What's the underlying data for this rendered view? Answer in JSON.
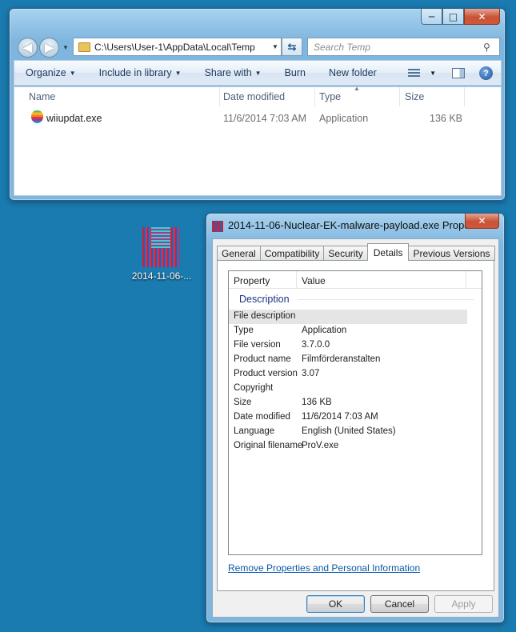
{
  "explorer": {
    "caption_buttons": {
      "minimize": "─",
      "maximize": "□",
      "close": "✕"
    },
    "address": "C:\\Users\\User-1\\AppData\\Local\\Temp",
    "search_placeholder": "Search Temp",
    "toolbar": [
      "Organize",
      "Include in library",
      "Share with",
      "Burn",
      "New folder"
    ],
    "columns": {
      "name": "Name",
      "date": "Date modified",
      "type": "Type",
      "size": "Size"
    },
    "files": [
      {
        "name": "wiiupdat.exe",
        "date": "11/6/2014 7:03 AM",
        "type": "Application",
        "size": "136 KB",
        "icon": "apple-rainbow-icon"
      }
    ]
  },
  "desktop_icon": {
    "label": "2014-11-06-..."
  },
  "properties": {
    "title": "2014-11-06-Nuclear-EK-malware-payload.exe Proper...",
    "close": "✕",
    "tabs": [
      "General",
      "Compatibility",
      "Security",
      "Details",
      "Previous Versions"
    ],
    "active_tab": "Details",
    "header": {
      "property": "Property",
      "value": "Value"
    },
    "group": "Description",
    "rows": [
      {
        "k": "File description",
        "v": ""
      },
      {
        "k": "Type",
        "v": "Application"
      },
      {
        "k": "File version",
        "v": "3.7.0.0"
      },
      {
        "k": "Product name",
        "v": "Filmförderanstalten"
      },
      {
        "k": "Product version",
        "v": "3.07"
      },
      {
        "k": "Copyright",
        "v": ""
      },
      {
        "k": "Size",
        "v": "136 KB"
      },
      {
        "k": "Date modified",
        "v": "11/6/2014 7:03 AM"
      },
      {
        "k": "Language",
        "v": "English (United States)"
      },
      {
        "k": "Original filename",
        "v": "ProV.exe"
      }
    ],
    "remove_link": "Remove Properties and Personal Information",
    "buttons": {
      "ok": "OK",
      "cancel": "Cancel",
      "apply": "Apply"
    }
  }
}
